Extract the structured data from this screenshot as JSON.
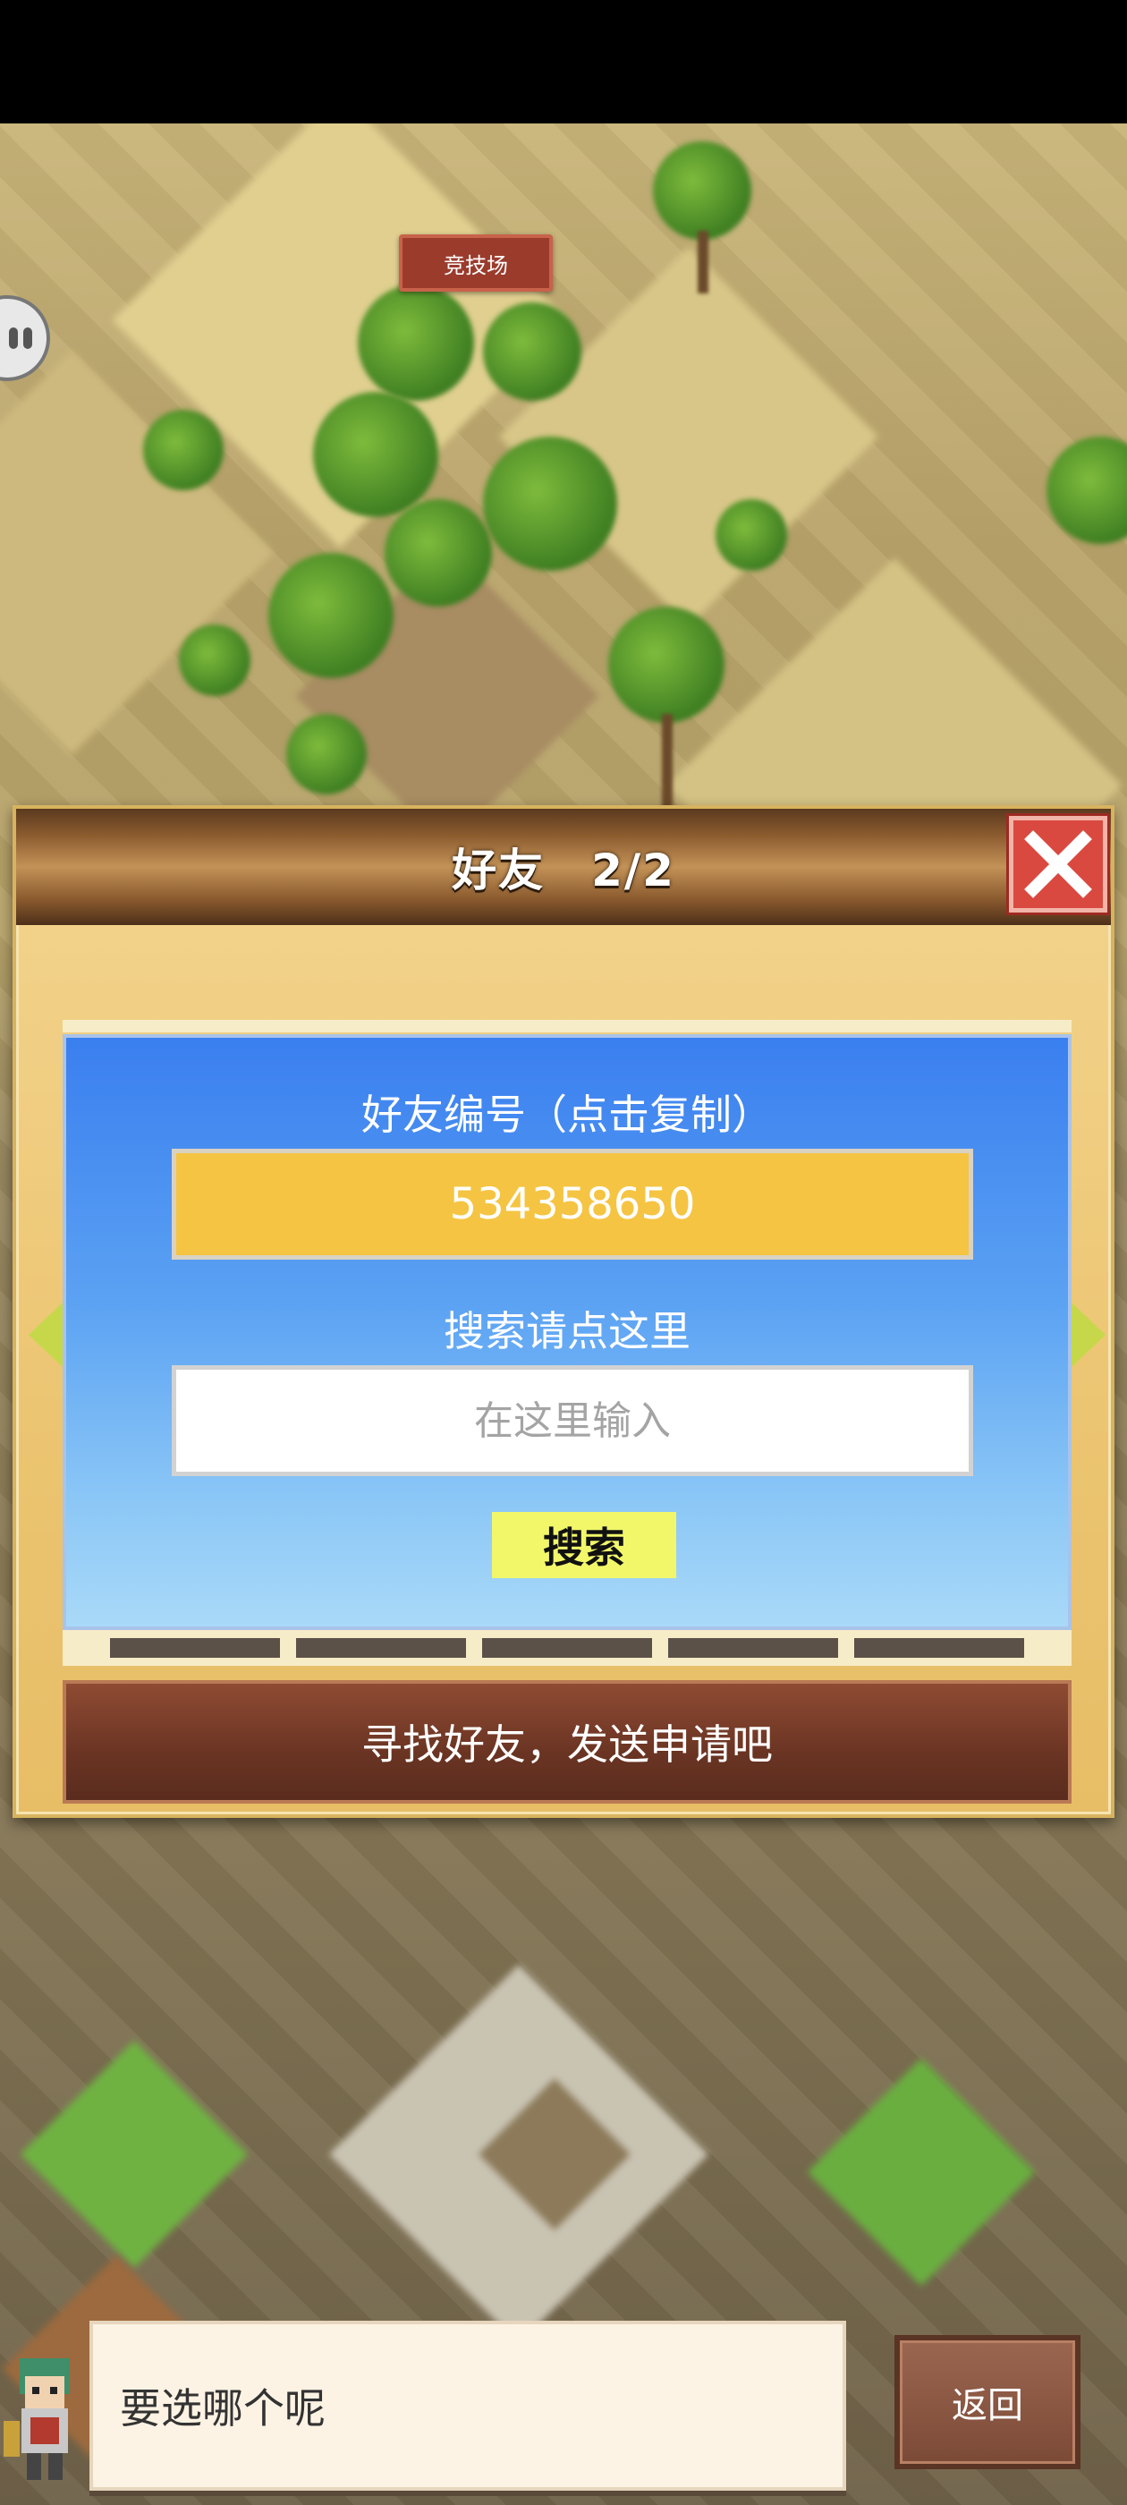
{
  "map": {
    "arena_sign": "竞技场"
  },
  "dialog": {
    "title": "好友　2/2",
    "friend_id_label": "好友编号（点击复制）",
    "friend_id_value": "534358650",
    "search_label": "搜索请点这里",
    "search_placeholder": "在这里输入",
    "search_button": "搜索",
    "find_friends_button": "寻找好友，发送申请吧"
  },
  "bottom": {
    "speech_text": "要选哪个呢",
    "back_button": "返回"
  },
  "colors": {
    "friend_id_box": "#f5c442",
    "search_button": "#f2f76a",
    "close_button": "#d9493f",
    "panel_blue": "#3a7fef"
  },
  "icons": {
    "close": "close-x-icon",
    "prev": "arrow-left-icon",
    "next": "arrow-right-icon",
    "side_menu": "pause-icon"
  }
}
